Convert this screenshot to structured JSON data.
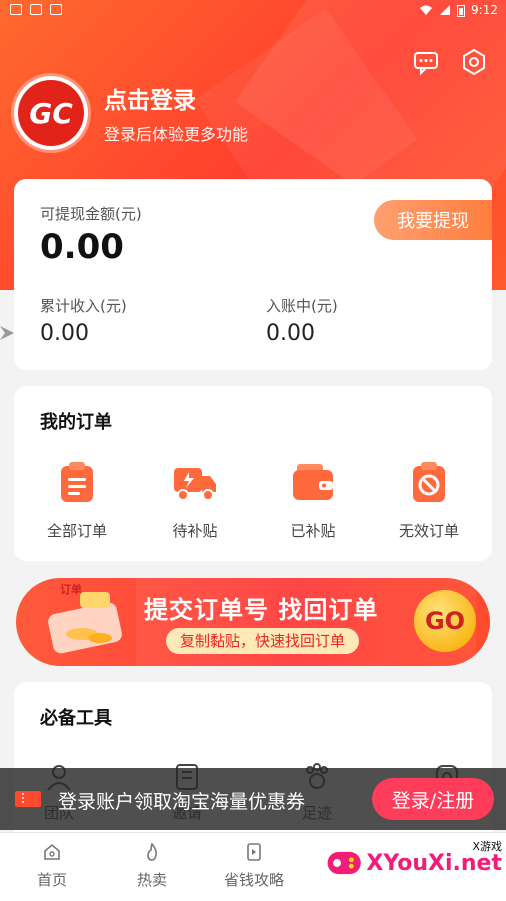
{
  "status_bar": {
    "time": "9:12"
  },
  "profile": {
    "avatar_text": "GC",
    "title": "点击登录",
    "subtitle": "登录后体验更多功能"
  },
  "balance": {
    "withdrawable_label": "可提现金额(元)",
    "withdrawable_value": "0.00",
    "withdraw_button": "我要提现",
    "total_income_label": "累计收入(元)",
    "total_income_value": "0.00",
    "pending_label": "入账中(元)",
    "pending_value": "0.00"
  },
  "orders": {
    "title": "我的订单",
    "items": [
      {
        "label": "全部订单",
        "icon": "clipboard-icon"
      },
      {
        "label": "待补贴",
        "icon": "truck-icon"
      },
      {
        "label": "已补贴",
        "icon": "wallet-icon"
      },
      {
        "label": "无效订单",
        "icon": "ban-icon"
      }
    ]
  },
  "banner": {
    "tag": "订单",
    "main": "提交订单号 找回订单",
    "sub": "复制黏贴，快速找回订单",
    "go": "GO"
  },
  "tools": {
    "title": "必备工具",
    "items": [
      {
        "label": "团队",
        "icon": "team-icon"
      },
      {
        "label": "邀请",
        "icon": "invite-icon"
      },
      {
        "label": "足迹",
        "icon": "footprint-icon"
      },
      {
        "label": "",
        "icon": "service-icon"
      }
    ]
  },
  "login_prompt": {
    "text": "登录账户领取淘宝海量优惠券",
    "button": "登录/注册"
  },
  "tabbar": {
    "items": [
      {
        "label": "首页",
        "icon": "home-icon"
      },
      {
        "label": "热卖",
        "icon": "fire-icon"
      },
      {
        "label": "省钱攻略",
        "icon": "guide-icon"
      }
    ]
  },
  "watermark": {
    "brand": "XYouXi",
    "suffix": ".net",
    "tag": "X游戏"
  },
  "colors": {
    "accent": "#ff4a2e",
    "withdraw_button": "#ff8a50",
    "login_button": "#ff3d5a",
    "banner_go": "#f9b91d"
  }
}
